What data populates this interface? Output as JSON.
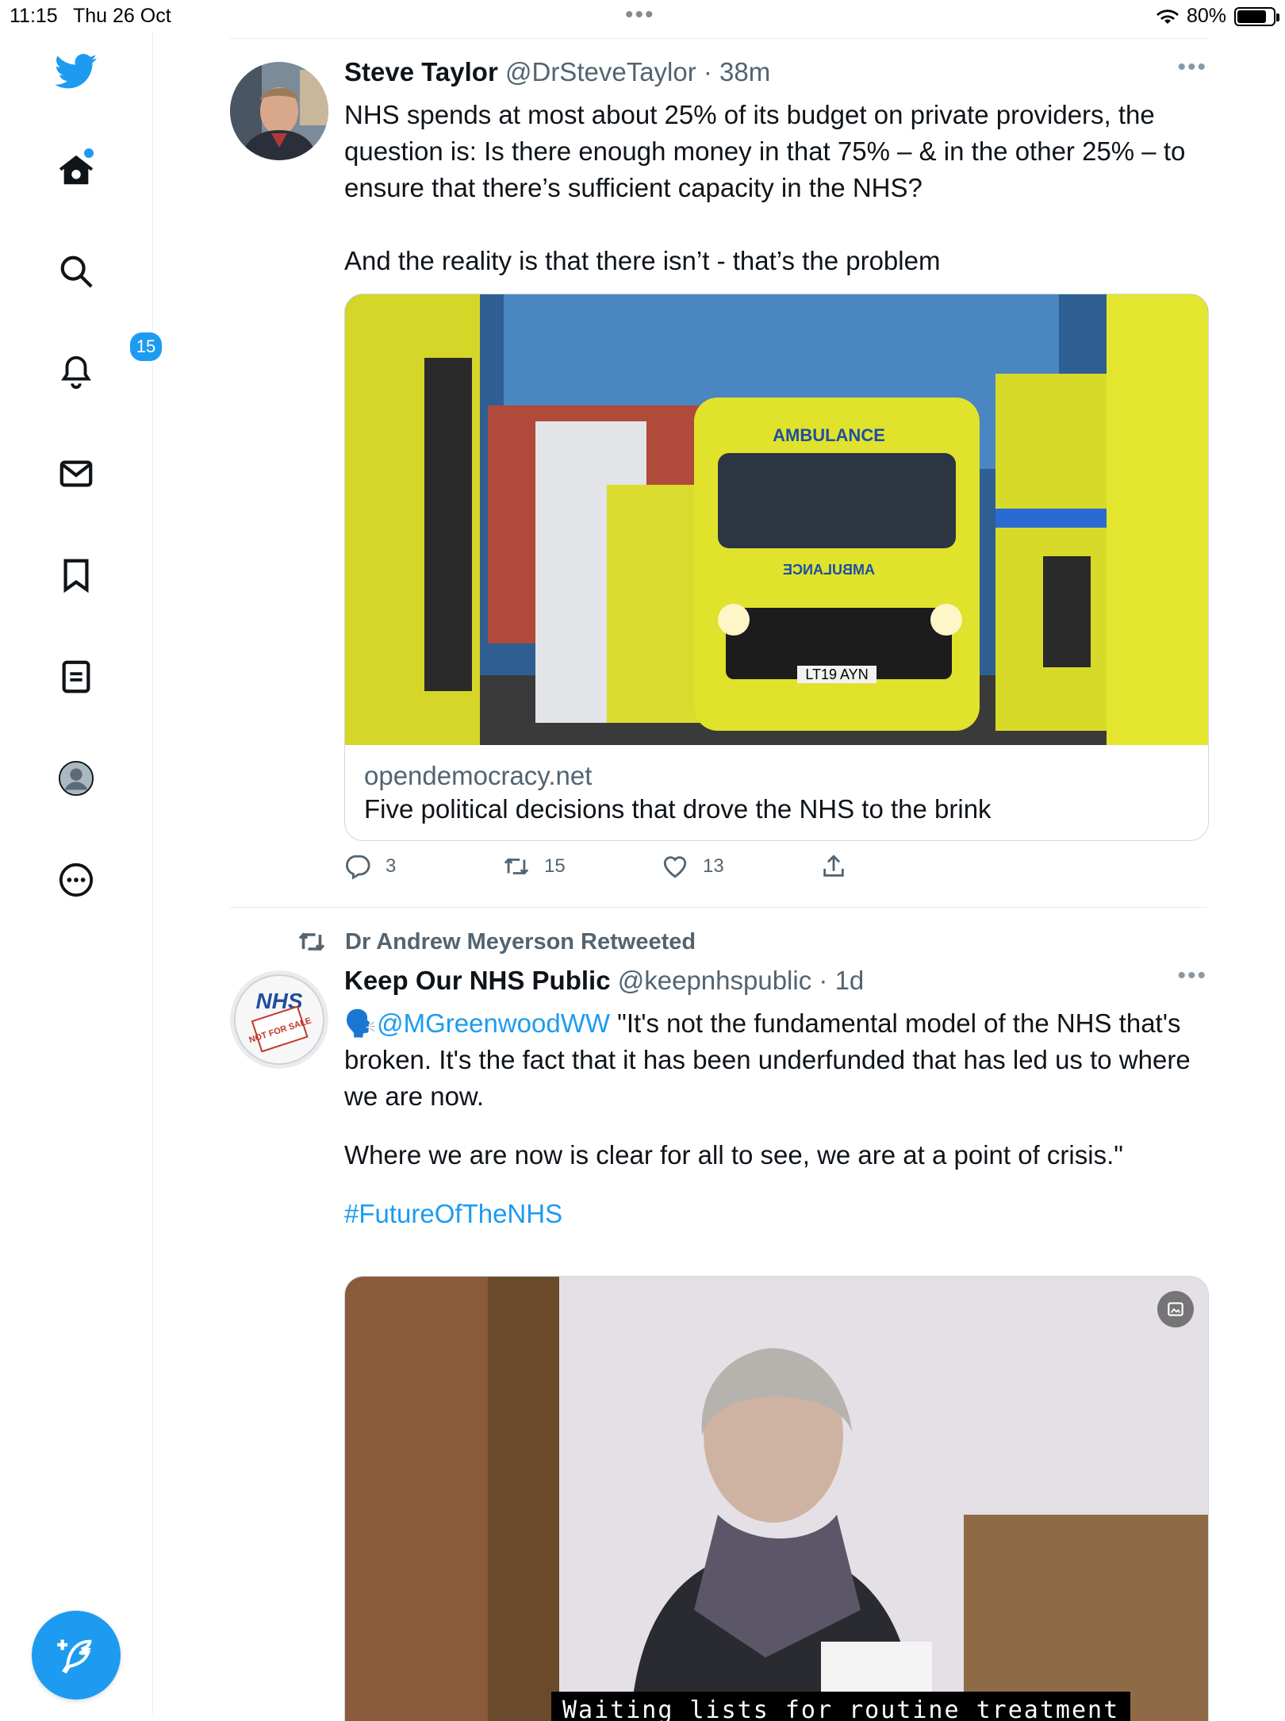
{
  "status_bar": {
    "time": "11:15",
    "date": "Thu 26 Oct",
    "battery": "80%"
  },
  "sidebar": {
    "notifications_badge": "15"
  },
  "tweets": [
    {
      "name": "Steve Taylor",
      "handle": "@DrSteveTaylor",
      "time": "· 38m",
      "text_1": "NHS spends at most about 25% of its budget on private providers, the question is: Is there enough money in that 75% – & in the other 25% – to ensure that there’s sufficient capacity in the NHS?",
      "text_2": "And the reality is that there isn’t - that’s the problem",
      "card": {
        "domain": "opendemocracy.net",
        "title": "Five political decisions that drove the NHS to the brink",
        "image_label_1": "AMBULANCE",
        "image_label_2": "AMBULANCE",
        "plate": "LT19 AYN"
      },
      "replies": "3",
      "retweets": "15",
      "likes": "13"
    },
    {
      "retweeted_by": "Dr Andrew Meyerson Retweeted",
      "name": "Keep Our NHS Public",
      "handle": "@keepnhspublic",
      "time": "· 1d",
      "mention": "@MGreenwoodWW",
      "text_1": " \"It's not the fundamental model of the NHS that's broken. It's the fact that it has been underfunded that has led us to where we are now.",
      "text_2": "Where we are now is clear for all to see, we are at a point of crisis.\"",
      "hashtag": "#FutureOfTheNHS",
      "avatar_text": "NHS",
      "avatar_sub": "NOT FOR SALE",
      "video_subtitle": "Waiting lists for routine treatment"
    }
  ]
}
